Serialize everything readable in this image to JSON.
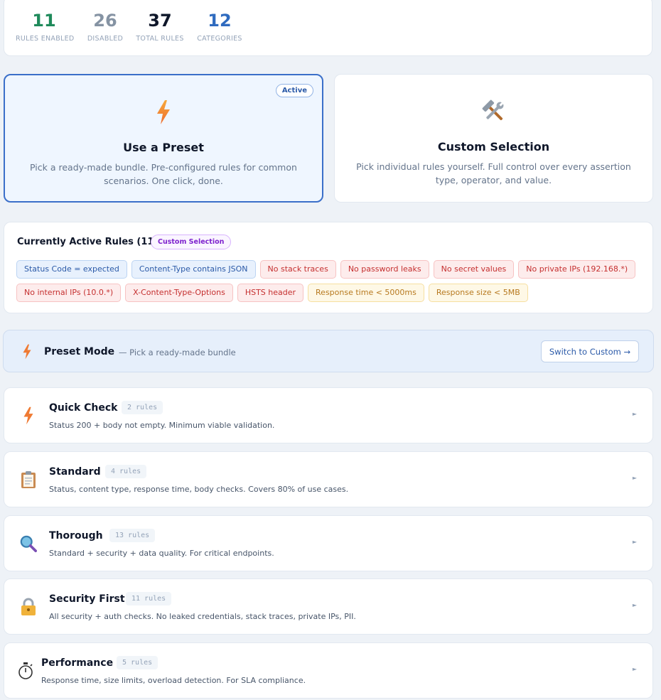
{
  "stats": [
    {
      "value": "11",
      "label": "RULES ENABLED",
      "color": "#1f8a5b"
    },
    {
      "value": "26",
      "label": "DISABLED",
      "color": "#8593a3"
    },
    {
      "value": "37",
      "label": "TOTAL RULES",
      "color": "#0f172a"
    },
    {
      "value": "12",
      "label": "CATEGORIES",
      "color": "#2f6bbf"
    }
  ],
  "modes": {
    "preset": {
      "icon": "lightning-icon",
      "title": "Use a Preset",
      "description": "Pick a ready-made bundle. Pre-configured rules for common scenarios. One click, done.",
      "badge": "Active"
    },
    "custom": {
      "icon": "hammer-wrench-icon",
      "title": "Custom Selection",
      "description": "Pick individual rules yourself. Full control over every assertion type, operator, and value."
    }
  },
  "active_rules": {
    "title": "Currently Active Rules (11)",
    "mode_chip": "Custom Selection",
    "chips": [
      {
        "label": "Status Code = expected",
        "tone": "blue"
      },
      {
        "label": "Content-Type contains JSON",
        "tone": "blue"
      },
      {
        "label": "No stack traces",
        "tone": "red"
      },
      {
        "label": "No password leaks",
        "tone": "red"
      },
      {
        "label": "No secret values",
        "tone": "red"
      },
      {
        "label": "No private IPs (192.168.*)",
        "tone": "red"
      },
      {
        "label": "No internal IPs (10.0.*)",
        "tone": "red"
      },
      {
        "label": "X-Content-Type-Options",
        "tone": "red"
      },
      {
        "label": "HSTS header",
        "tone": "red"
      },
      {
        "label": "Response time < 5000ms",
        "tone": "amber"
      },
      {
        "label": "Response size < 5MB",
        "tone": "amber"
      }
    ]
  },
  "preset_bar": {
    "icon": "lightning-icon",
    "title": "Preset Mode",
    "subtitle": "— Pick a ready-made bundle",
    "switch_label": "Switch to Custom →"
  },
  "presets": [
    {
      "name": "Quick Check",
      "count": "2 rules",
      "description": "Status 200 + body not empty. Minimum viable validation.",
      "icon": "lightning-icon"
    },
    {
      "name": "Standard",
      "count": "4 rules",
      "description": "Status, content type, response time, body checks. Covers 80% of use cases.",
      "icon": "clipboard-icon"
    },
    {
      "name": "Thorough",
      "count": "13 rules",
      "description": "Standard + security + data quality. For critical endpoints.",
      "icon": "magnifier-icon"
    },
    {
      "name": "Security First",
      "count": "11 rules",
      "description": "All security + auth checks. No leaked credentials, stack traces, private IPs, PII.",
      "icon": "lock-icon"
    },
    {
      "name": "Performance",
      "count": "5 rules",
      "description": "Response time, size limits, overload detection. For SLA compliance.",
      "icon": "stopwatch-icon"
    }
  ],
  "colors": {
    "accent": "#3b6fc9",
    "security": "#c53030",
    "performance": "#b7791f"
  }
}
